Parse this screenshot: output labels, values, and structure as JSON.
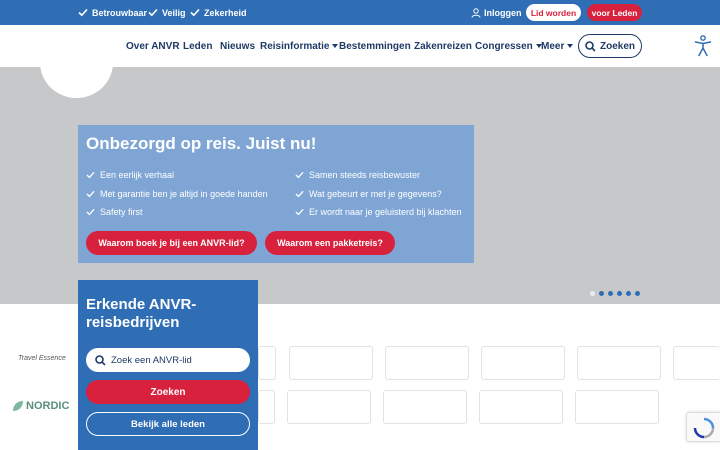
{
  "topbar": {
    "trust_items": [
      "Betrouwbaar",
      "Veilig",
      "Zekerheid"
    ],
    "login": "Inloggen",
    "join": "Lid worden",
    "members": "voor Leden"
  },
  "nav": {
    "items": [
      "Over ANVR",
      "Leden",
      "Nieuws",
      "Reisinformatie",
      "Bestemmingen",
      "Zakenreizen",
      "Congressen",
      "Meer"
    ],
    "search": "Zoeken"
  },
  "hero": {
    "title": "Onbezorgd op reis. Juist nu!",
    "bullets_left": [
      "Een eerlijk verhaal",
      "Met garantie ben je altijd in goede handen",
      "Safety first"
    ],
    "bullets_right": [
      "Samen steeds reisbewuster",
      "Wat gebeurt er met je gegevens?",
      "Er wordt naar je geluisterd bij klachten"
    ],
    "button_1": "Waarom boek je bij een ANVR-lid?",
    "button_2": "Waarom een pakketreis?"
  },
  "members": {
    "title": "Erkende ANVR-reisbedrijven",
    "placeholder": "Zoek een ANVR-lid",
    "search": "Zoeken",
    "all": "Bekijk alle leden"
  },
  "logos": [
    "Travel Essence",
    "NORDIC"
  ],
  "colors": {
    "primary": "#2f6db5",
    "accent": "#d7213d",
    "navy": "#1f3a66"
  }
}
